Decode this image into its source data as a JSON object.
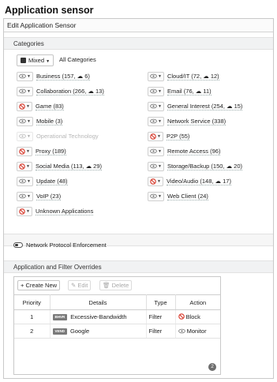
{
  "page_heading": "Application sensor",
  "panel_title": "Edit Application Sensor",
  "categories_header": "Categories",
  "mixed_label": "Mixed",
  "all_categories_label": "All Categories",
  "categories_left": [
    {
      "label": "Business (157, ☁ 6)",
      "action": "monitor",
      "disabled": false
    },
    {
      "label": "Collaboration (266, ☁ 13)",
      "action": "monitor",
      "disabled": false
    },
    {
      "label": "Game (83)",
      "action": "block",
      "disabled": false
    },
    {
      "label": "Mobile (3)",
      "action": "monitor",
      "disabled": false
    },
    {
      "label": "Operational Technology",
      "action": "monitor",
      "disabled": true
    },
    {
      "label": "Proxy (189)",
      "action": "block",
      "disabled": false
    },
    {
      "label": "Social Media (113, ☁ 29)",
      "action": "block",
      "disabled": false
    },
    {
      "label": "Update (48)",
      "action": "monitor",
      "disabled": false
    },
    {
      "label": "VoIP (23)",
      "action": "monitor",
      "disabled": false
    },
    {
      "label": "Unknown Applications",
      "action": "block",
      "disabled": false
    }
  ],
  "categories_right": [
    {
      "label": "Cloud/IT (72, ☁ 12)",
      "action": "monitor",
      "disabled": false
    },
    {
      "label": "Email (76, ☁ 11)",
      "action": "monitor",
      "disabled": false
    },
    {
      "label": "General Interest (254, ☁ 15)",
      "action": "monitor",
      "disabled": false
    },
    {
      "label": "Network Service (338)",
      "action": "monitor",
      "disabled": false
    },
    {
      "label": "P2P (55)",
      "action": "block",
      "disabled": false
    },
    {
      "label": "Remote Access (96)",
      "action": "monitor",
      "disabled": false
    },
    {
      "label": "Storage/Backup (150, ☁ 20)",
      "action": "monitor",
      "disabled": false
    },
    {
      "label": "Video/Audio (148, ☁ 17)",
      "action": "block",
      "disabled": false
    },
    {
      "label": "Web Client (24)",
      "action": "monitor",
      "disabled": false
    }
  ],
  "npe_label": "Network Protocol Enforcement",
  "overrides_header": "Application and Filter Overrides",
  "toolbar": {
    "create": "+ Create New",
    "edit": "Edit",
    "delete": "Delete"
  },
  "table": {
    "headers": [
      "Priority",
      "Details",
      "Type",
      "Action"
    ],
    "rows": [
      {
        "priority": "1",
        "tag": "BHVR",
        "details": "Excessive-Bandwidth",
        "type": "Filter",
        "action": "Block",
        "action_icon": "block"
      },
      {
        "priority": "2",
        "tag": "VEND",
        "details": "Google",
        "type": "Filter",
        "action": "Monitor",
        "action_icon": "monitor"
      }
    ],
    "count": "2"
  },
  "colors": {
    "block": "#d9392b",
    "monitor": "#666666",
    "panel_border": "#c9c9c9"
  }
}
